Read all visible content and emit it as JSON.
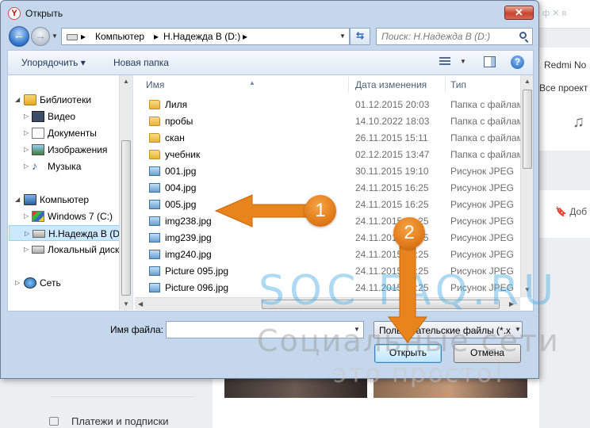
{
  "background": {
    "top_text": "ф ✕ я",
    "redmi": "Redmi No",
    "projects": "Все проект",
    "bookmark_label": "Доб",
    "payments_label": "Платежи и подписки"
  },
  "dialog": {
    "title": "Открыть",
    "address": {
      "crumbs": [
        "Компьютер",
        "Н.Надежда В (D:)"
      ]
    },
    "search": {
      "placeholder": "Поиск: Н.Надежда В (D:)"
    },
    "toolbar": {
      "organize": "Упорядочить ▾",
      "new_folder": "Новая папка"
    },
    "nav": {
      "items": [
        {
          "label": "Библиотеки"
        },
        {
          "label": "Видео"
        },
        {
          "label": "Документы"
        },
        {
          "label": "Изображения"
        },
        {
          "label": "Музыка"
        },
        {
          "label": "Компьютер"
        },
        {
          "label": "Windows 7 (C:)"
        },
        {
          "label": "Н.Надежда В (D:)"
        },
        {
          "label": "Локальный диск"
        },
        {
          "label": "Сеть"
        }
      ]
    },
    "columns": {
      "name": "Имя",
      "date": "Дата изменения",
      "type": "Тип"
    },
    "files": [
      {
        "name": "Лиля",
        "date": "01.12.2015 20:03",
        "type": "Папка с файлами",
        "kind": "folder"
      },
      {
        "name": "пробы",
        "date": "14.10.2022 18:03",
        "type": "Папка с файлами",
        "kind": "folder"
      },
      {
        "name": "скан",
        "date": "26.11.2015 15:11",
        "type": "Папка с файлами",
        "kind": "folder"
      },
      {
        "name": "учебник",
        "date": "02.12.2015 13:47",
        "type": "Папка с файлами",
        "kind": "folder"
      },
      {
        "name": "001.jpg",
        "date": "30.11.2015 19:10",
        "type": "Рисунок JPEG",
        "kind": "jpg"
      },
      {
        "name": "004.jpg",
        "date": "24.11.2015 16:25",
        "type": "Рисунок JPEG",
        "kind": "jpg"
      },
      {
        "name": "005.jpg",
        "date": "24.11.2015 16:25",
        "type": "Рисунок JPEG",
        "kind": "jpg"
      },
      {
        "name": "img238.jpg",
        "date": "24.11.2015 16:25",
        "type": "Рисунок JPEG",
        "kind": "jpg"
      },
      {
        "name": "img239.jpg",
        "date": "24.11.2015 16:25",
        "type": "Рисунок JPEG",
        "kind": "jpg"
      },
      {
        "name": "img240.jpg",
        "date": "24.11.2015 16:25",
        "type": "Рисунок JPEG",
        "kind": "jpg"
      },
      {
        "name": "Picture 095.jpg",
        "date": "24.11.2015 16:25",
        "type": "Рисунок JPEG",
        "kind": "jpg"
      },
      {
        "name": "Picture 096.jpg",
        "date": "24.11.2015 16:25",
        "type": "Рисунок JPEG",
        "kind": "jpg"
      }
    ],
    "filename": {
      "label": "Имя файла:",
      "value": ""
    },
    "filter": {
      "value": "Пользовательские файлы (*.x"
    },
    "buttons": {
      "open": "Открыть",
      "cancel": "Отмена"
    }
  },
  "annotations": {
    "badge1": "1",
    "badge2": "2",
    "watermark_line1": "SOC FAQ.RU",
    "watermark_line2": "Социальные сети",
    "watermark_line3": "это просто!",
    "arrow_color": "#e8841c"
  }
}
